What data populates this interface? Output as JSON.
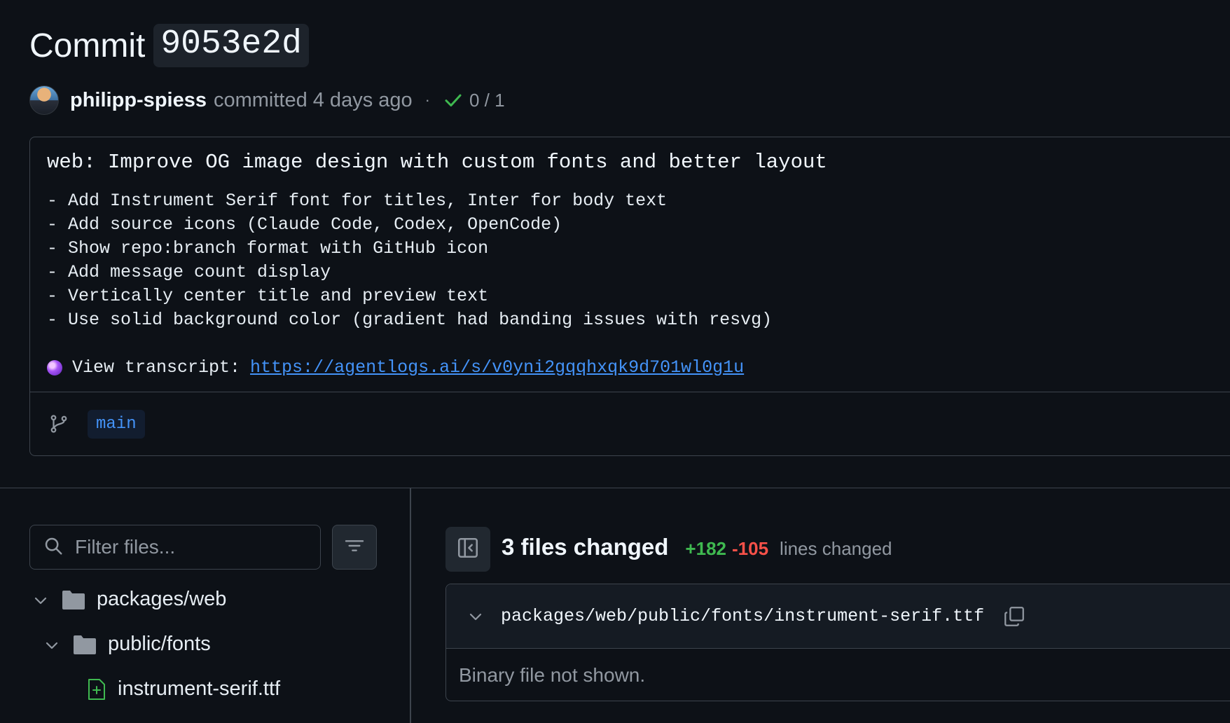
{
  "header": {
    "title_word": "Commit",
    "sha": "9053e2d"
  },
  "meta": {
    "author": "philipp-spiess",
    "action": "committed",
    "time": "4 days ago",
    "separator": "·",
    "checks": "0 / 1"
  },
  "commit_message": {
    "title": "web: Improve OG image design with custom fonts and better layout",
    "lines": [
      "- Add Instrument Serif font for titles, Inter for body text",
      "- Add source icons (Claude Code, Codex, OpenCode)",
      "- Show repo:branch format with GitHub icon",
      "- Add message count display",
      "- Vertically center title and preview text",
      "- Use solid background color (gradient had banding issues with resvg)"
    ],
    "transcript_label": "View transcript:",
    "transcript_url": "https://agentlogs.ai/s/v0yni2gqqhxqk9d701wl0g1u"
  },
  "branch": {
    "name": "main"
  },
  "file_tree": {
    "filter_placeholder": "Filter files...",
    "items": [
      {
        "label": "packages/web",
        "type": "folder"
      },
      {
        "label": "public/fonts",
        "type": "folder"
      },
      {
        "label": "instrument-serif.ttf",
        "type": "file-added"
      }
    ]
  },
  "diff": {
    "files_changed": "3 files changed",
    "additions": "+182",
    "deletions": "-105",
    "lines_changed": "lines changed",
    "files": [
      {
        "path": "packages/web/public/fonts/instrument-serif.ttf",
        "body": "Binary file not shown."
      }
    ]
  },
  "colors": {
    "background": "#0d1117",
    "border": "#3d444d",
    "link": "#4493f8",
    "added": "#3fb950",
    "deleted": "#f85149",
    "muted": "#9198a1"
  },
  "icons": [
    "check-icon",
    "git-branch-icon",
    "search-icon",
    "filter-icon",
    "chevron-down-icon",
    "folder-icon",
    "file-added-icon",
    "sidebar-collapse-icon",
    "copy-icon",
    "crystal-ball-icon"
  ]
}
